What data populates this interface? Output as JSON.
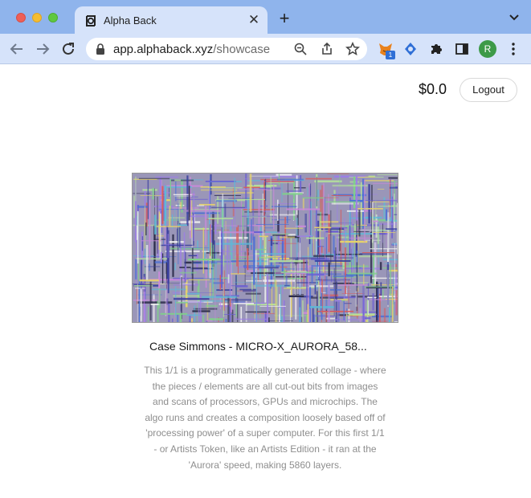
{
  "browser": {
    "tab_title": "Alpha Back",
    "new_tab_symbol": "+",
    "close_symbol": "✕",
    "url_host": "app.alphaback.xyz",
    "url_path": "/showcase",
    "extension_badge": "1",
    "profile_initial": "R",
    "icons": [
      "back-arrow-icon",
      "forward-arrow-icon",
      "reload-icon",
      "lock-icon",
      "zoom-icon",
      "share-icon",
      "star-icon",
      "fox-extension-icon",
      "blue-extension-icon",
      "puzzle-icon",
      "side-panel-icon",
      "kebab-menu-icon",
      "chevron-down-icon"
    ]
  },
  "header": {
    "balance": "$0.0",
    "logout_label": "Logout"
  },
  "artwork": {
    "title": "Case Simmons - MICRO-X_AURORA_58...",
    "description": "This 1/1 is a programmatically generated collage - where the pieces / elements are all cut-out bits from images and scans of processors, GPUs and microchips. The algo runs and creates a composition loosely based off of 'processing power' of a super computer. For this first 1/1 - or Artists Token, like an Artists Edition - it ran at the 'Aurora' speed, making 5860 layers."
  },
  "colors": {
    "tabstrip": "#8fb4ec",
    "toolbar": "#d6e3fa",
    "avatar": "#3c9a48"
  }
}
